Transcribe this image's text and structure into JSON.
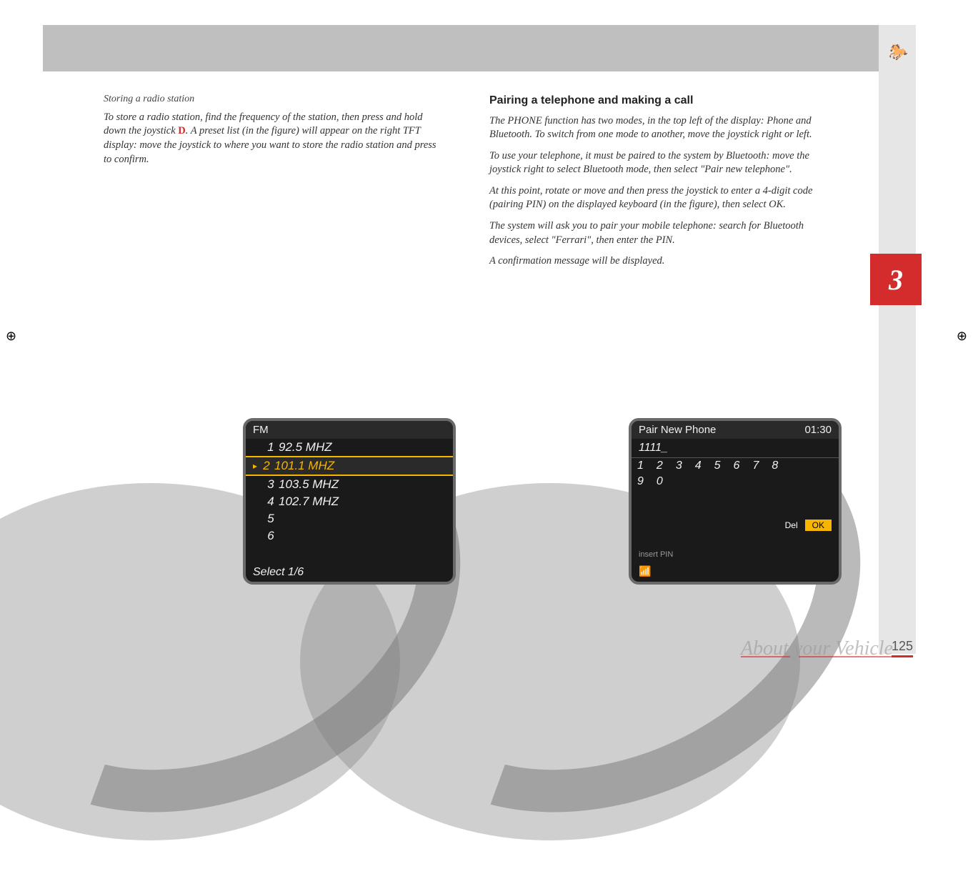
{
  "section_number": "3",
  "page_number": "125",
  "watermark": "About your Vehicle",
  "left": {
    "heading": "Storing a radio station",
    "p1a": "To store a radio station, find the frequency of the station, then press and hold down the joystick ",
    "p1_red": "D",
    "p1b": ". A preset list (in the figure) will appear on the right TFT display: move the joystick to where you want to store the radio station and press to confirm."
  },
  "right": {
    "heading": "Pairing a telephone and making a call",
    "p1": "The PHONE function has two modes, in the top left of the display: Phone and Bluetooth. To switch from one mode to another, move the joystick right or left.",
    "p2": "To use your telephone, it must be paired to the system by Bluetooth: move the joystick right to select Bluetooth mode, then select \"Pair new telephone\".",
    "p3": "At this point, rotate or move and then press the joystick to enter a 4-digit code (pairing PIN) on the displayed keyboard (in the figure), then select OK.",
    "p4": "The system will ask you to pair your mobile telephone: search for Bluetooth devices, select \"Ferrari\", then enter the PIN.",
    "p5": "A confirmation message will be displayed."
  },
  "dash_left": {
    "title": "FM",
    "presets": [
      {
        "num": "1",
        "freq": "92.5  MHZ",
        "active": false
      },
      {
        "num": "2",
        "freq": "101.1  MHZ",
        "active": true
      },
      {
        "num": "3",
        "freq": "103.5  MHZ",
        "active": false
      },
      {
        "num": "4",
        "freq": "102.7  MHZ",
        "active": false
      },
      {
        "num": "5",
        "freq": "",
        "active": false
      },
      {
        "num": "6",
        "freq": "",
        "active": false
      }
    ],
    "footer": "Select 1/6"
  },
  "dash_right": {
    "title": "Pair New Phone",
    "time": "01:30",
    "pin": "1111_",
    "row1": [
      "1",
      "2",
      "3",
      "4",
      "5",
      "6",
      "7",
      "8"
    ],
    "row2": [
      "9",
      "0"
    ],
    "del": "Del",
    "ok": "OK",
    "hint": "insert PIN"
  }
}
